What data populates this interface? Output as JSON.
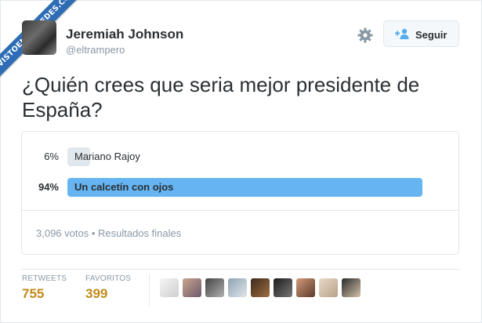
{
  "watermark": {
    "text": "VISTOENLASREDES.COM"
  },
  "author": {
    "name": "Jeremiah Johnson",
    "handle": "@eltrampero"
  },
  "actions": {
    "follow_label": "Seguir",
    "gear_icon": "gear-icon",
    "follow_icon": "add-user-icon"
  },
  "tweet": {
    "text": "¿Quién crees que seria mejor presidente de España?"
  },
  "poll": {
    "options": [
      {
        "percent": "6%",
        "label": "Mariano Rajoy",
        "value": 0.06,
        "color": "#e1e8ed",
        "winner": false
      },
      {
        "percent": "94%",
        "label": "Un calcetín con ojos",
        "value": 0.94,
        "color": "#66b5f2",
        "winner": true
      }
    ],
    "footer": "3,096 votos • Resultados finales"
  },
  "stats": {
    "retweets_label": "RETWEETS",
    "retweets_value": "755",
    "favorites_label": "FAVORITOS",
    "favorites_value": "399"
  },
  "favoriters": {
    "count": 9
  }
}
